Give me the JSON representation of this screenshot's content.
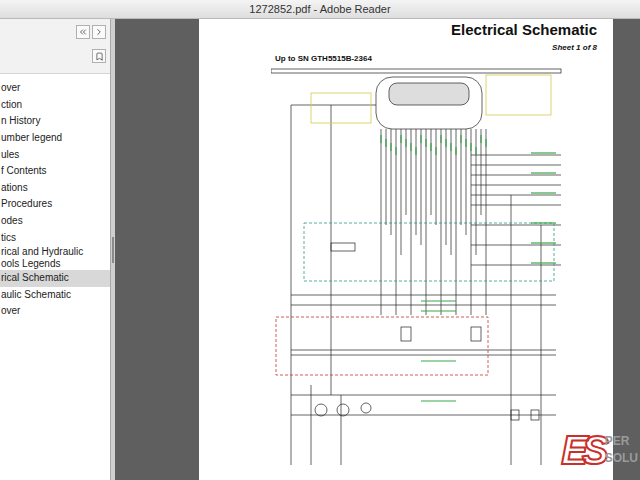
{
  "window": {
    "title": "1272852.pdf - Adobe Reader"
  },
  "sidebar": {
    "items": [
      {
        "lines": [
          "over"
        ],
        "selected": false
      },
      {
        "lines": [
          "ction"
        ],
        "selected": false
      },
      {
        "lines": [
          "n History"
        ],
        "selected": false
      },
      {
        "lines": [
          "umber legend"
        ],
        "selected": false
      },
      {
        "lines": [
          "ules"
        ],
        "selected": false
      },
      {
        "lines": [
          "f Contents"
        ],
        "selected": false
      },
      {
        "lines": [
          "ations"
        ],
        "selected": false
      },
      {
        "lines": [
          "Procedures"
        ],
        "selected": false
      },
      {
        "lines": [
          "odes"
        ],
        "selected": false
      },
      {
        "lines": [
          "tics"
        ],
        "selected": false
      },
      {
        "lines": [
          "rical and Hydraulic",
          "ools Legends"
        ],
        "selected": false
      },
      {
        "lines": [
          "rical Schematic"
        ],
        "selected": true
      },
      {
        "lines": [
          "aulic Schematic"
        ],
        "selected": false
      },
      {
        "lines": [
          "over"
        ],
        "selected": false
      }
    ]
  },
  "document": {
    "title": "Electrical Schematic",
    "sheet": "Sheet 1 of 8",
    "subtitle": "Up to SN GTH5515B-2364"
  },
  "watermark": {
    "mark": "ES",
    "lines": [
      "PER",
      "SOLU"
    ]
  }
}
